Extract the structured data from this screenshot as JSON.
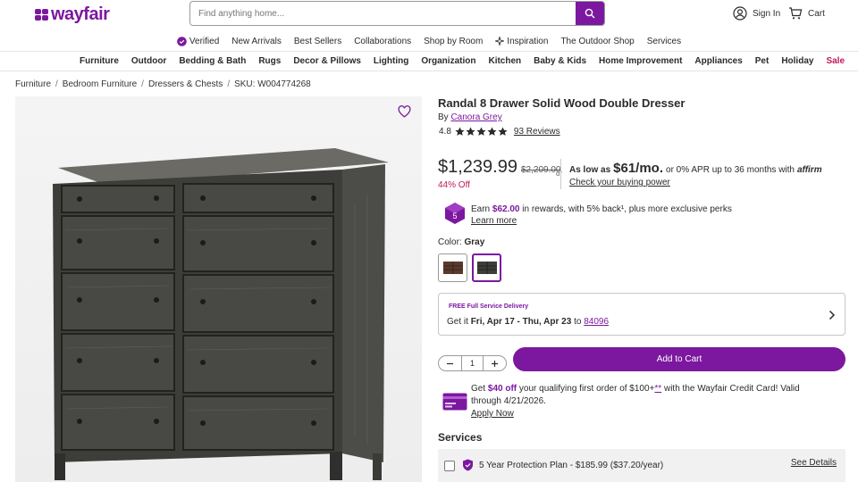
{
  "header": {
    "logo_text": "wayfair",
    "search_placeholder": "Find anything home...",
    "sign_in": "Sign In",
    "cart": "Cart"
  },
  "subnav": [
    "Verified",
    "New Arrivals",
    "Best Sellers",
    "Collaborations",
    "Shop by Room",
    "Inspiration",
    "The Outdoor Shop",
    "Services"
  ],
  "categories": [
    "Furniture",
    "Outdoor",
    "Bedding & Bath",
    "Rugs",
    "Decor & Pillows",
    "Lighting",
    "Organization",
    "Kitchen",
    "Baby & Kids",
    "Home Improvement",
    "Appliances",
    "Pet",
    "Holiday",
    "Sale"
  ],
  "breadcrumb": [
    "Furniture",
    "Bedroom Furniture",
    "Dressers & Chests",
    "SKU: W004774268"
  ],
  "product": {
    "title": "Randal 8 Drawer Solid Wood Double Dresser",
    "by": "By",
    "brand": "Canora Grey",
    "rating": "4.8",
    "reviews": "93 Reviews",
    "price": "$1,239.99",
    "was_price": "$2,209.00",
    "discount": "44% Off",
    "or": "or",
    "as_low_as": "As low as",
    "monthly": "$61/mo.",
    "apr_text": "or 0% APR up to 36 months with",
    "affirm": "affirm",
    "buying_power": "Check your buying power",
    "rewards_earn": "Earn",
    "rewards_amount": "$62.00",
    "rewards_rest": "in rewards, with 5% back¹, plus more exclusive perks",
    "learn_more": "Learn more",
    "color_label": "Color:",
    "color_value": "Gray",
    "delivery_label": "FREE Full Service Delivery",
    "delivery_prefix": "Get it",
    "delivery_dates": "Fri, Apr 17 - Thu, Apr 23",
    "delivery_to": "to",
    "zip": "84096",
    "quantity": "1",
    "add_to_cart": "Add to Cart",
    "cc_get": "Get",
    "cc_amount": "$40 off",
    "cc_rest1": "your qualifying first order of $100+",
    "cc_star": "**",
    "cc_rest2": "with the Wayfair Credit Card! Valid through 4/21/2026.",
    "apply_now": "Apply Now",
    "services_heading": "Services",
    "plan_text": "5 Year Protection Plan - $185.99 ($37.20/year)",
    "see_details": "See Details"
  },
  "colors": {
    "brand": "#7b189f",
    "sale": "#c2185b"
  }
}
